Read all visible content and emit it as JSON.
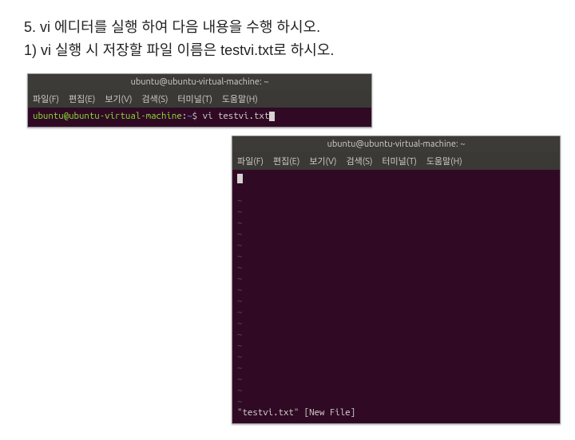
{
  "instructions": {
    "line1": "5. vi 에디터를 실행 하여 다음 내용을 수행 하시오.",
    "line2": "1) vi 실행 시  저장할 파일 이름은 testvi.txt로 하시오."
  },
  "terminal1": {
    "title": "ubuntu@ubuntu-virtual-machine: ~",
    "menu": {
      "file": "파일(F)",
      "edit": "편집(E)",
      "view": "보기(V)",
      "search": "검색(S)",
      "terminal": "터미널(T)",
      "help": "도움말(H)"
    },
    "prompt_user": "ubuntu@ubuntu-virtual-machine",
    "prompt_sep": ":",
    "prompt_path": "~",
    "prompt_dollar": "$ ",
    "command": "vi testvi.txt"
  },
  "terminal2": {
    "title": "ubuntu@ubuntu-virtual-machine: ~",
    "menu": {
      "file": "파일(F)",
      "edit": "편집(E)",
      "view": "보기(V)",
      "search": "검색(S)",
      "terminal": "터미널(T)",
      "help": "도움말(H)"
    },
    "tilde": "~",
    "tilde_count": 19,
    "status": "\"testvi.txt\" [New File]"
  }
}
